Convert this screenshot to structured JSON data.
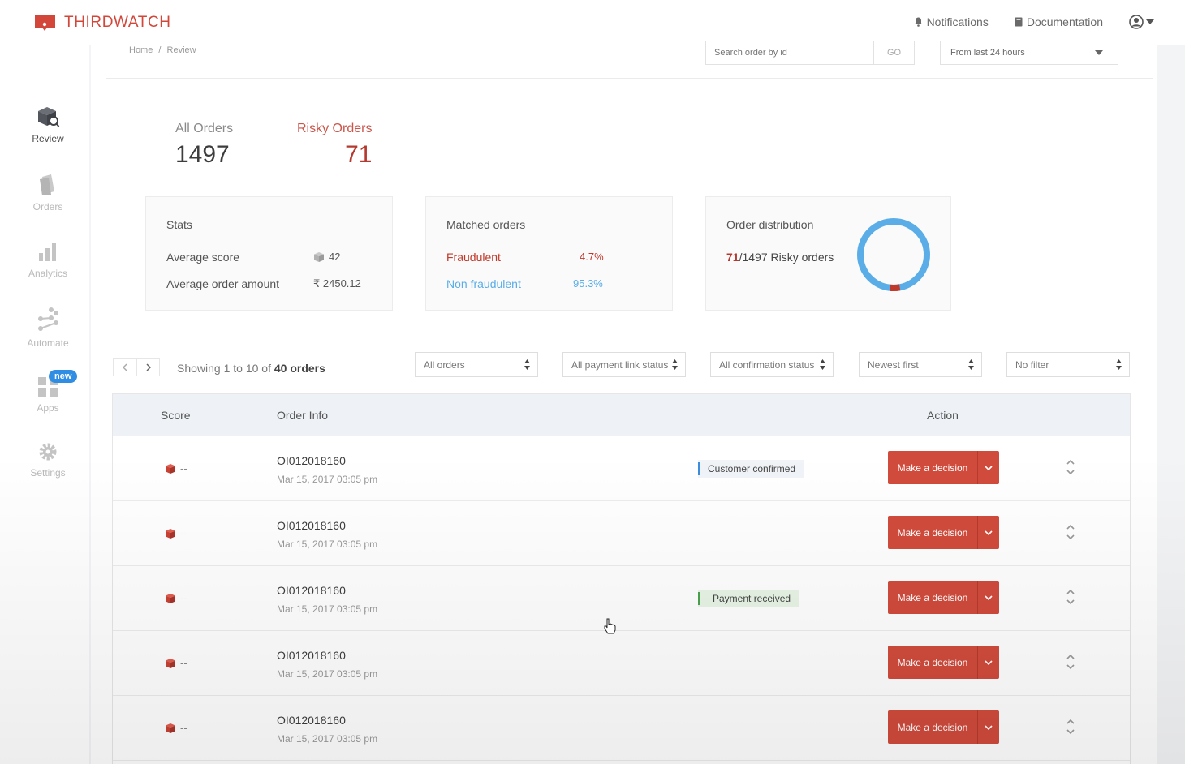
{
  "brand": {
    "name": "THIRDWATCH",
    "color": "#d2473a"
  },
  "topnav": {
    "notifications": "Notifications",
    "documentation": "Documentation"
  },
  "sidebar": {
    "items": [
      {
        "label": "Review",
        "icon": "review-icon",
        "active": true
      },
      {
        "label": "Orders",
        "icon": "orders-icon",
        "active": false
      },
      {
        "label": "Analytics",
        "icon": "analytics-icon",
        "active": false
      },
      {
        "label": "Automate",
        "icon": "automate-icon",
        "active": false
      },
      {
        "label": "Apps",
        "icon": "apps-icon",
        "active": false,
        "badge": "new"
      },
      {
        "label": "Settings",
        "icon": "gear-icon",
        "active": false
      }
    ]
  },
  "breadcrumb": {
    "home": "Home",
    "sep": "/",
    "current": "Review"
  },
  "search": {
    "placeholder": "Search order by id",
    "go": "GO"
  },
  "time_filter": {
    "value": "From last 24 hours"
  },
  "counters": {
    "all": {
      "label": "All Orders",
      "value": "1497"
    },
    "risky": {
      "label": "Risky Orders",
      "value": "71"
    }
  },
  "stats": {
    "title": "Stats",
    "avg_score_label": "Average score",
    "avg_score_value": "42",
    "avg_amount_label": "Average order amount",
    "avg_amount_value": "₹ 2450.12"
  },
  "matched": {
    "title": "Matched orders",
    "fraud_label": "Fraudulent",
    "fraud_value": "4.7%",
    "nonfraud_label": "Non fraudulent",
    "nonfraud_value": "95.3%",
    "fraud_color": "#c0392b",
    "nonfraud_color": "#5aade6"
  },
  "distribution": {
    "title": "Order distribution",
    "risky": "71",
    "rest": "/1497 Risky orders",
    "risky_fraction": 0.0474
  },
  "list": {
    "showing_prefix": "Showing 1 to 10 of ",
    "showing_total": "40 orders"
  },
  "filters": [
    "All orders",
    "All payment link status",
    "All confirmation status",
    "Newest first",
    "No filter"
  ],
  "table": {
    "headers": {
      "score": "Score",
      "order_info": "Order Info",
      "action": "Action"
    },
    "action_label": "Make a decision",
    "rows": [
      {
        "score": "--",
        "order_id": "OI012018160",
        "date": "Mar 15, 2017 03:05 pm",
        "tag": "Customer confirmed",
        "tag_color": "blue"
      },
      {
        "score": "--",
        "order_id": "OI012018160",
        "date": "Mar 15, 2017 03:05 pm",
        "tag": "",
        "tag_color": ""
      },
      {
        "score": "--",
        "order_id": "OI012018160",
        "date": "Mar 15, 2017 03:05 pm",
        "tag": "Payment received",
        "tag_color": "green"
      },
      {
        "score": "--",
        "order_id": "OI012018160",
        "date": "Mar 15, 2017 03:05 pm",
        "tag": "",
        "tag_color": ""
      },
      {
        "score": "--",
        "order_id": "OI012018160",
        "date": "Mar 15, 2017 03:05 pm",
        "tag": "",
        "tag_color": ""
      }
    ]
  }
}
